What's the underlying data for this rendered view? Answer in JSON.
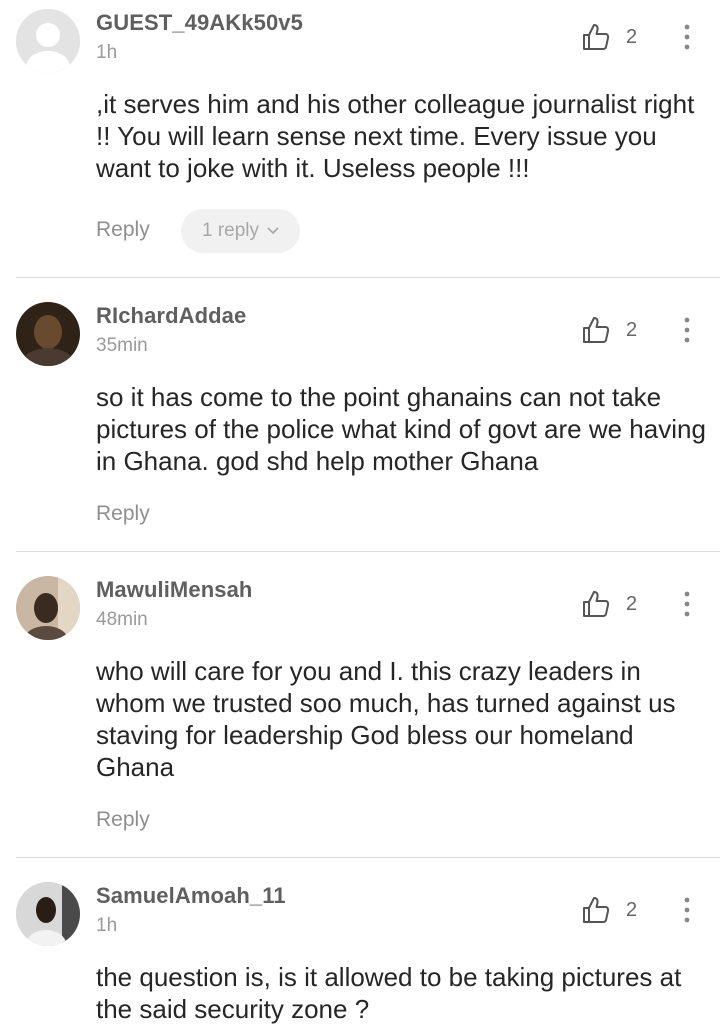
{
  "comments": [
    {
      "username": "GUEST_49AKk50v5",
      "time": "1h",
      "likes": "2",
      "text": ",it serves him and his other colleague journalist right !! You will learn sense next time. Every issue you want to joke with it. Useless people !!!",
      "reply_label": "Reply",
      "replies_label": "1 reply",
      "avatar": "default-avatar-icon"
    },
    {
      "username": "RIchardAddae",
      "time": "35min",
      "likes": "2",
      "text": "so it has come to the point ghanains can not take pictures of the police what kind of govt are we having in Ghana. god shd help mother Ghana",
      "reply_label": "Reply",
      "avatar": "profile-photo"
    },
    {
      "username": "MawuliMensah",
      "time": "48min",
      "likes": "2",
      "text": "who will care for you and I. this crazy leaders in whom we trusted soo much, has turned against us staving for leadership God bless our homeland Ghana",
      "reply_label": "Reply",
      "avatar": "profile-photo"
    },
    {
      "username": "SamuelAmoah_11",
      "time": "1h",
      "likes": "2",
      "text": "the question is, is it allowed to be taking pictures at the said security zone ?",
      "avatar": "profile-photo"
    }
  ],
  "colors": {
    "divider": "#dddddd",
    "username": "#5f5f5f",
    "meta": "#9a9a9a",
    "pill_bg": "#f1f1f1"
  },
  "icons": [
    "thumbs-up-icon",
    "more-vertical-icon",
    "chevron-down-icon",
    "default-avatar-icon"
  ]
}
